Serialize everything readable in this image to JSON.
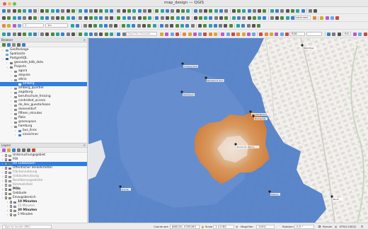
{
  "window": {
    "title": "map_design — QGIS"
  },
  "toolbar": {
    "map_tips_placeholder": "MapTiler Geocodi...",
    "catchment_label": "Catchment",
    "raster_band": "RGB",
    "roi_label": "ROI",
    "scale_field_value": "1",
    "scale_select_value": "1m"
  },
  "browser": {
    "title": "Browser",
    "items": [
      {
        "label": "GeoPackage",
        "indent": 0,
        "arrow": "›",
        "icon": "gpkg"
      },
      {
        "label": "SpatiaLite",
        "indent": 0,
        "arrow": "",
        "icon": "spatialite"
      },
      {
        "label": "PostgreSQL",
        "indent": 0,
        "arrow": "⌄",
        "icon": "postgres"
      },
      {
        "label": "geonode_b4b_data",
        "indent": 1,
        "arrow": "›",
        "icon": "db"
      },
      {
        "label": "Projects",
        "indent": 1,
        "arrow": "⌄",
        "icon": "db"
      },
      {
        "label": "agora",
        "indent": 2,
        "arrow": "›",
        "icon": "schema"
      },
      {
        "label": "akquise",
        "indent": 2,
        "arrow": "›",
        "icon": "schema"
      },
      {
        "label": "attrio",
        "indent": 2,
        "arrow": "⌄",
        "icon": "schema"
      },
      {
        "label": "amberg",
        "indent": 3,
        "arrow": "",
        "icon": "table",
        "selected": true
      },
      {
        "label": "amberg_quartier",
        "indent": 2,
        "arrow": "›",
        "icon": "schema"
      },
      {
        "label": "augsburg",
        "indent": 2,
        "arrow": "›",
        "icon": "schema"
      },
      {
        "label": "berufsschule_freising",
        "indent": 2,
        "arrow": "›",
        "icon": "schema"
      },
      {
        "label": "controlled_access",
        "indent": 2,
        "arrow": "›",
        "icon": "schema"
      },
      {
        "label": "de_dev_gueste/lease",
        "indent": 2,
        "arrow": "›",
        "icon": "schema"
      },
      {
        "label": "duesseldorf",
        "indent": 2,
        "arrow": "›",
        "icon": "schema"
      },
      {
        "label": "fifteen_minutes",
        "indent": 2,
        "arrow": "›",
        "icon": "schema"
      },
      {
        "label": "flaks",
        "indent": 2,
        "arrow": "›",
        "icon": "schema"
      },
      {
        "label": "greenspace",
        "indent": 2,
        "arrow": "›",
        "icon": "schema"
      },
      {
        "label": "hamburg",
        "indent": 2,
        "arrow": "⌄",
        "icon": "schema"
      },
      {
        "label": "bus_lines",
        "indent": 3,
        "arrow": "›",
        "icon": "line"
      },
      {
        "label": "einsichner",
        "indent": 3,
        "arrow": "›",
        "icon": "line"
      }
    ]
  },
  "layers": {
    "title": "Layers",
    "items": [
      {
        "label": "Untersuchungsgebiet",
        "indent": 0,
        "checked": false,
        "muted": false,
        "bold": false,
        "icon": "#ffffff"
      },
      {
        "label": "POI",
        "indent": 0,
        "checked": true,
        "muted": false,
        "bold": false,
        "icon": "#333333"
      },
      {
        "label": "ÖV Gütelassen",
        "indent": 0,
        "checked": true,
        "muted": false,
        "bold": false,
        "icon": "#4a7bd0",
        "selected": true
      },
      {
        "label": "Öffentlicher Verkehrmittel",
        "indent": 0,
        "checked": true,
        "muted": false,
        "bold": false,
        "icon": "#7b4aa5"
      },
      {
        "label": "Flächennutzung",
        "indent": 0,
        "checked": false,
        "muted": true,
        "bold": false,
        "icon": "#bdbdbd"
      },
      {
        "label": "Gebäudenutzung",
        "indent": 0,
        "checked": false,
        "muted": true,
        "bold": false,
        "icon": "#bdbdbd"
      },
      {
        "label": "Bevölkerungsdichte",
        "indent": 0,
        "checked": false,
        "muted": true,
        "bold": false,
        "icon": "#bdbdbd"
      },
      {
        "label": "Kimmellsfeld",
        "indent": 0,
        "checked": false,
        "muted": true,
        "bold": false,
        "icon": "#bdbdbd"
      },
      {
        "label": "POIs",
        "indent": 0,
        "checked": true,
        "muted": false,
        "bold": true,
        "icon": "#333333"
      },
      {
        "label": "Gebäude",
        "indent": 0,
        "checked": true,
        "muted": false,
        "bold": false,
        "icon": "#9b9b9b"
      },
      {
        "label": "Einzugsbereich",
        "indent": 0,
        "checked": true,
        "muted": false,
        "bold": false,
        "icon": "#e88b3a"
      },
      {
        "label": "10 Minuten",
        "indent": 1,
        "checked": true,
        "muted": false,
        "bold": true,
        "icon": "#6b93d6"
      },
      {
        "label": "15 Minuten",
        "indent": 1,
        "checked": true,
        "muted": true,
        "bold": false,
        "icon": "#9fb7e3"
      },
      {
        "label": "30 Minuten",
        "indent": 1,
        "checked": true,
        "muted": false,
        "bold": true,
        "icon": "#e39a55"
      },
      {
        "label": "5 Minuten",
        "indent": 1,
        "checked": true,
        "muted": false,
        "bold": false,
        "icon": "#f3c8a1"
      }
    ]
  },
  "map_labels": [
    {
      "text": "Amberg Park"
    },
    {
      "text": "Pausenhof Sud"
    },
    {
      "text": "Stadtwerk"
    },
    {
      "text": "Hauptbahnhof"
    },
    {
      "text": "Marktplatz"
    },
    {
      "text": "Kirche St. Martin"
    },
    {
      "text": "Schule"
    },
    {
      "text": "Stadion"
    },
    {
      "text": "Klinik"
    },
    {
      "text": "Bibliothek"
    }
  ],
  "status": {
    "locate_placeholder": "Type to locate (⌘K)",
    "coordinate_label": "Coordinate",
    "coordinate_value": "688150, 5335283",
    "scale_label": "Scale",
    "scale_value": "1:11785",
    "magnifier_label": "Magnifier",
    "magnifier_value": "100%",
    "rotation_label": "Rotation",
    "rotation_value": "0,0 °",
    "render_label": "Render",
    "crs_label": "EPSG:25832"
  },
  "colors": {
    "accent": "#2f7fe0",
    "isochrone_blue": "#5b86c9",
    "isochrone_orange": "#e08b3f",
    "map_bg": "#f3f1ee"
  }
}
